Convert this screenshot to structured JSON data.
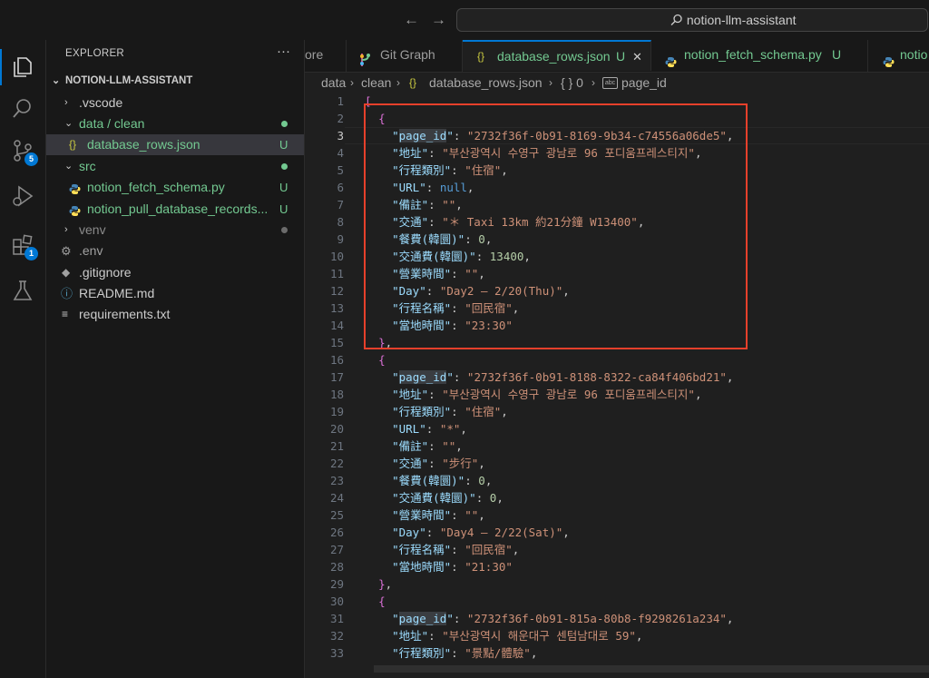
{
  "titlebar": {
    "search_text": "notion-llm-assistant",
    "back": "←",
    "forward": "→"
  },
  "activity": {
    "items": [
      {
        "name": "explorer"
      },
      {
        "name": "search"
      },
      {
        "name": "source-control",
        "badge": "5"
      },
      {
        "name": "run-debug"
      },
      {
        "name": "extensions",
        "badge": "1"
      },
      {
        "name": "testing"
      }
    ]
  },
  "explorer": {
    "title": "EXPLORER",
    "more": "···",
    "root": "NOTION-LLM-ASSISTANT",
    "rows": [
      {
        "chev": "›",
        "label": ".vscode",
        "status": ""
      },
      {
        "chev": "⌄",
        "label": "data / clean",
        "status": "dot"
      },
      {
        "icon": "{}",
        "label": "database_rows.json",
        "status": "U"
      },
      {
        "chev": "⌄",
        "label": "src",
        "status": "dot"
      },
      {
        "icon": "py",
        "label": "notion_fetch_schema.py",
        "status": "U"
      },
      {
        "icon": "py",
        "label": "notion_pull_database_records...",
        "status": "U"
      },
      {
        "chev": "›",
        "label": "venv",
        "status": "dot-grey"
      },
      {
        "icon": "gear",
        "label": ".env",
        "status": ""
      },
      {
        "icon": "diamond",
        "label": ".gitignore",
        "status": ""
      },
      {
        "icon": "info",
        "label": "README.md",
        "status": ""
      },
      {
        "icon": "lines",
        "label": "requirements.txt",
        "status": ""
      }
    ]
  },
  "tabs": [
    {
      "label": "ore",
      "status": ""
    },
    {
      "label": "Git Graph",
      "status": ""
    },
    {
      "label": "database_rows.json",
      "status": "U",
      "close": "✕"
    },
    {
      "label": "notion_fetch_schema.py",
      "status": "U"
    },
    {
      "label": "notio",
      "status": ""
    }
  ],
  "breadcrumb": {
    "items": [
      "data",
      "clean",
      "database_rows.json",
      "{ } 0",
      "page_id"
    ],
    "sep": ">"
  },
  "editor": {
    "line_numbers": [
      "1",
      "2",
      "3",
      "4",
      "5",
      "6",
      "7",
      "8",
      "9",
      "10",
      "11",
      "12",
      "13",
      "14",
      "15",
      "16",
      "17",
      "18",
      "19",
      "20",
      "21",
      "22",
      "23",
      "24",
      "25",
      "26",
      "27",
      "28",
      "29",
      "30",
      "31",
      "32",
      "33"
    ],
    "current_line": "3",
    "records": [
      {
        "page_id": "\"2732f36f-0b91-8169-9b34-c74556a06de5\"",
        "address": "\"부산광역시 수영구 광남로 96 포디움프레스티지\"",
        "category": "\"住宿\"",
        "url": "null",
        "note": "\"\"",
        "transport": "\"＊ Taxi 13km 約21分鐘 W13400\"",
        "meal": "0",
        "transport_fee": "13400",
        "hours": "\"\"",
        "day": "\"Day2 – 2/20(Thu)\"",
        "name": "\"回民宿\"",
        "time": "\"23:30\""
      },
      {
        "page_id": "\"2732f36f-0b91-8188-8322-ca84f406bd21\"",
        "address": "\"부산광역시 수영구 광남로 96 포디움프레스티지\"",
        "category": "\"住宿\"",
        "url": "\"*\"",
        "note": "\"\"",
        "transport": "\"步行\"",
        "meal": "0",
        "transport_fee": "0",
        "hours": "\"\"",
        "day": "\"Day4 – 2/22(Sat)\"",
        "name": "\"回民宿\"",
        "time": "\"21:30\""
      },
      {
        "page_id": "\"2732f36f-0b91-815a-80b8-f9298261a234\"",
        "address": "\"부산광역시 해운대구 센텀남대로 59\"",
        "category": "\"景點/體驗\""
      }
    ],
    "keys": {
      "page_id": "\"page_id\"",
      "address": "\"地址\"",
      "category": "\"行程類別\"",
      "url": "\"URL\"",
      "note": "\"備註\"",
      "transport": "\"交通\"",
      "meal": "\"餐費(韓圜)\"",
      "transport_fee": "\"交通費(韓圜)\"",
      "hours": "\"營業時間\"",
      "day": "\"Day\"",
      "name": "\"行程名稱\"",
      "time": "\"當地時間\""
    },
    "bracket_open_array": "[",
    "brace_open": "{",
    "brace_close_comma": "},"
  },
  "colors": {
    "accent": "#0078d4",
    "highlight_box": "#e6402b",
    "untracked": "#73c991"
  }
}
